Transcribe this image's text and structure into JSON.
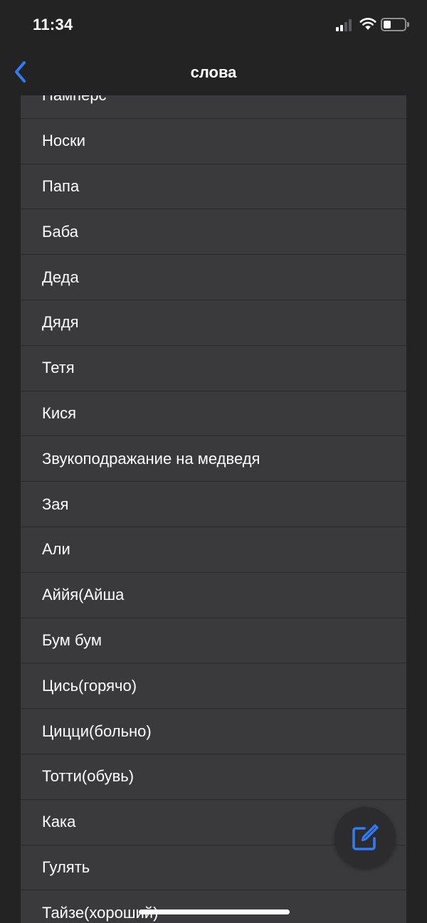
{
  "status_bar": {
    "time": "11:34",
    "icons": [
      "cellular-signal-icon",
      "wifi-icon",
      "battery-icon"
    ],
    "signal_bars_active": 2,
    "signal_bars_total": 4,
    "battery_level": 0.35
  },
  "nav": {
    "title": "слова",
    "back_icon": "chevron-left-icon"
  },
  "words": [
    "Памперс",
    "Носки",
    "Папа",
    "Баба",
    "Деда",
    "Дядя",
    "Тетя",
    "Кися",
    "Звукоподражание на медведя",
    "Зая",
    "Али",
    "Аййя(Айша",
    "Бум бум",
    "Цись(горячо)",
    "Цицци(больно)",
    "Тотти(обувь)",
    "Кака",
    "Гулять",
    "Тайзе(хороший)"
  ],
  "compose_button": {
    "icon": "compose-icon"
  },
  "colors": {
    "background": "#232323",
    "row_background": "#3a3a3c",
    "accent": "#2f7cf6",
    "text": "#ffffff",
    "fab_background": "#2c2c2e"
  }
}
